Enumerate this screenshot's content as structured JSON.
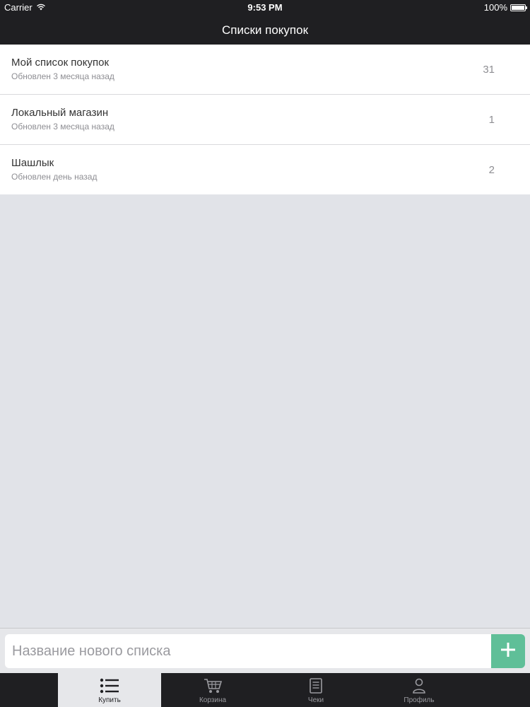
{
  "status_bar": {
    "carrier": "Carrier",
    "time": "9:53 PM",
    "battery": "100%",
    "wifi_icon": "wifi-icon",
    "battery_icon": "battery-icon"
  },
  "nav": {
    "title": "Списки покупок"
  },
  "lists": [
    {
      "title": "Мой список покупок",
      "subtitle": "Обновлен 3 месяца назад",
      "count": "31"
    },
    {
      "title": "Локальный магазин",
      "subtitle": "Обновлен 3 месяца назад",
      "count": "1"
    },
    {
      "title": "Шашлык",
      "subtitle": "Обновлен день назад",
      "count": "2"
    }
  ],
  "new_list": {
    "placeholder": "Название нового списка",
    "value": "",
    "add_icon": "plus-icon"
  },
  "tabs": [
    {
      "label": "Купить",
      "icon": "list-icon",
      "active": true
    },
    {
      "label": "Корзина",
      "icon": "cart-icon",
      "active": false
    },
    {
      "label": "Чеки",
      "icon": "receipt-icon",
      "active": false
    },
    {
      "label": "Профиль",
      "icon": "user-icon",
      "active": false
    }
  ],
  "colors": {
    "bar_background": "#1f1f22",
    "content_background": "#e1e3e8",
    "accent": "#5fbf98"
  }
}
